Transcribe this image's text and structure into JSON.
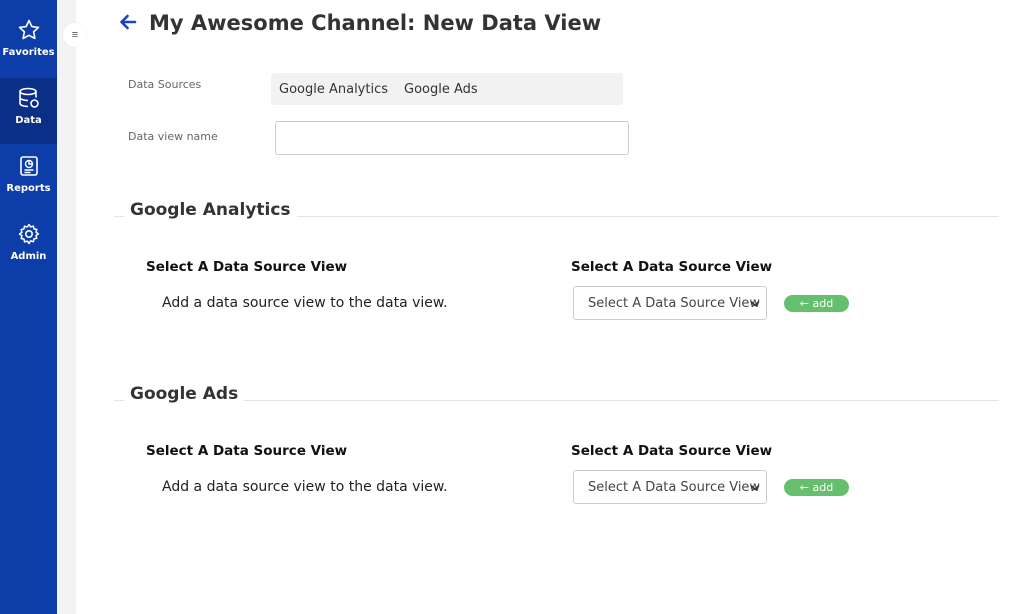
{
  "sidebar": {
    "items": [
      {
        "label": "Favorites",
        "icon": "star-icon"
      },
      {
        "label": "Data",
        "icon": "database-icon",
        "active": true
      },
      {
        "label": "Reports",
        "icon": "report-icon"
      },
      {
        "label": "Admin",
        "icon": "gear-icon"
      }
    ],
    "toggle_glyph": "≡"
  },
  "header": {
    "title": "My Awesome Channel: New Data View"
  },
  "form": {
    "sources_label": "Data Sources",
    "sources": [
      "Google Analytics",
      "Google Ads"
    ],
    "name_label": "Data view name",
    "name_value": ""
  },
  "sections": [
    {
      "title": "Google Analytics",
      "left_heading": "Select A Data Source View",
      "hint": "Add a data source view to the data view.",
      "right_heading": "Select A Data Source View",
      "select_value": "Select A Data Source View",
      "add_label": "← add"
    },
    {
      "title": "Google Ads",
      "left_heading": "Select A Data Source View",
      "hint": "Add a data source view to the data view.",
      "right_heading": "Select A Data Source View",
      "select_value": "Select A Data Source View",
      "add_label": "← add"
    }
  ],
  "colors": {
    "sidebar": "#0d3da8",
    "sidebar_active": "#0a2f86",
    "accent": "#1d44b8",
    "add_button": "#66bf6e"
  }
}
